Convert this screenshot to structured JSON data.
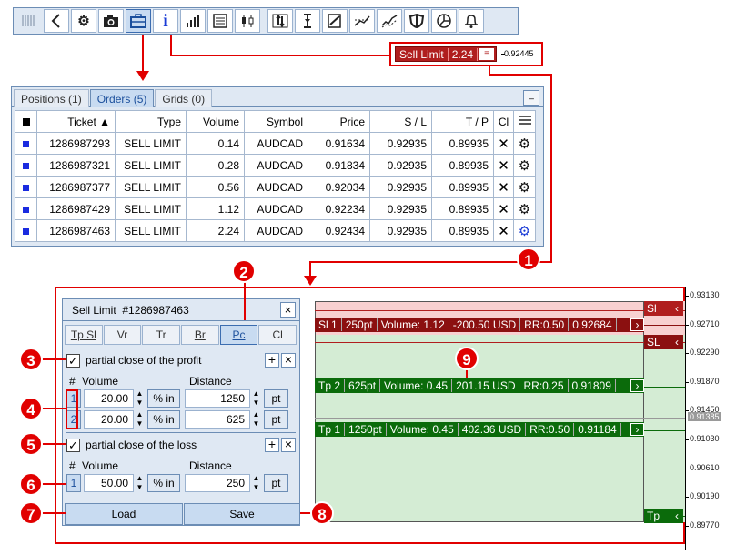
{
  "toolbar": {
    "icons": [
      "grip-icon",
      "back-arrow-icon",
      "gear-icon",
      "camera-icon",
      "briefcase-icon",
      "info-icon",
      "bar-chart-icon",
      "list-icon",
      "candlestick-icon",
      "arrows-vertical-icon",
      "cursor-text-icon",
      "document-edit-icon",
      "trend-line-icon",
      "trend-zigzag-icon",
      "shield-icon",
      "pie-chart-icon",
      "bell-icon"
    ],
    "info_glyph": "i"
  },
  "chip": {
    "label": "Sell Limit",
    "value": "2.24",
    "menu_glyph": "≡",
    "price": "0.92445"
  },
  "orders": {
    "tabs": [
      "Positions (1)",
      "Orders (5)",
      "Grids (0)"
    ],
    "active_tab": 1,
    "minimize": "_",
    "columns": [
      "",
      "Ticket ▲",
      "Type",
      "Volume",
      "Symbol",
      "Price",
      "S / L",
      "T / P",
      "Cl",
      ""
    ],
    "rows": [
      {
        "ticket": "1286987293",
        "type": "SELL LIMIT",
        "volume": "0.14",
        "symbol": "AUDCAD",
        "price": "0.91634",
        "sl": "0.92935",
        "tp": "0.89935"
      },
      {
        "ticket": "1286987321",
        "type": "SELL LIMIT",
        "volume": "0.28",
        "symbol": "AUDCAD",
        "price": "0.91834",
        "sl": "0.92935",
        "tp": "0.89935"
      },
      {
        "ticket": "1286987377",
        "type": "SELL LIMIT",
        "volume": "0.56",
        "symbol": "AUDCAD",
        "price": "0.92034",
        "sl": "0.92935",
        "tp": "0.89935"
      },
      {
        "ticket": "1286987429",
        "type": "SELL LIMIT",
        "volume": "1.12",
        "symbol": "AUDCAD",
        "price": "0.92234",
        "sl": "0.92935",
        "tp": "0.89935"
      },
      {
        "ticket": "1286987463",
        "type": "SELL LIMIT",
        "volume": "2.24",
        "symbol": "AUDCAD",
        "price": "0.92434",
        "sl": "0.92935",
        "tp": "0.89935"
      }
    ]
  },
  "badges": [
    "1",
    "2",
    "3",
    "4",
    "5",
    "6",
    "7",
    "8",
    "9"
  ],
  "dialog": {
    "title": "Sell Limit  #1286987463",
    "close": "×",
    "tabs": [
      "Tp Sl",
      "Vr",
      "Tr",
      "Br",
      "Pc",
      "Cl"
    ],
    "active_tab": 4,
    "profit": {
      "label": "partial close of the profit",
      "checked": "✓",
      "hdr_num": "#",
      "hdr_vol": "Volume",
      "hdr_dist": "Distance",
      "rows": [
        {
          "idx": "1",
          "vol": "20.00",
          "unit": "% in",
          "dist": "1250",
          "dunit": "pt"
        },
        {
          "idx": "2",
          "vol": "20.00",
          "unit": "% in",
          "dist": "625",
          "dunit": "pt"
        }
      ]
    },
    "loss": {
      "label": "partial close of the loss",
      "checked": "✓",
      "hdr_num": "#",
      "hdr_vol": "Volume",
      "hdr_dist": "Distance",
      "rows": [
        {
          "idx": "1",
          "vol": "50.00",
          "unit": "% in",
          "dist": "250",
          "dunit": "pt"
        }
      ]
    },
    "plus": "+",
    "minus": "×",
    "load": "Load",
    "save": "Save"
  },
  "chart": {
    "sl_bar": [
      "Sl 1",
      "250pt",
      "Volume: 1.12",
      "-200.50 USD",
      "RR:0.50",
      "0.92684"
    ],
    "tp2_bar": [
      "Tp 2",
      "625pt",
      "Volume: 0.45",
      "201.15 USD",
      "RR:0.25",
      "0.91809"
    ],
    "tp1_bar": [
      "Tp 1",
      "1250pt",
      "Volume: 0.45",
      "402.36 USD",
      "RR:0.50",
      "0.91184"
    ],
    "arrow": "›",
    "tags": {
      "sl_top": "Sl",
      "sl_mid": "SL",
      "tp": "Tp",
      "back": "‹"
    },
    "axis": [
      "0.93130",
      "0.92710",
      "0.92290",
      "0.91870",
      "0.91450",
      "0.91030",
      "0.90610",
      "0.90190",
      "0.89770"
    ],
    "current": "0.91385",
    "colors": {
      "sl": "#8b1010",
      "tp": "#0b6b0b",
      "pink": "#f8d0d0",
      "green": "#d4ecd4"
    }
  }
}
